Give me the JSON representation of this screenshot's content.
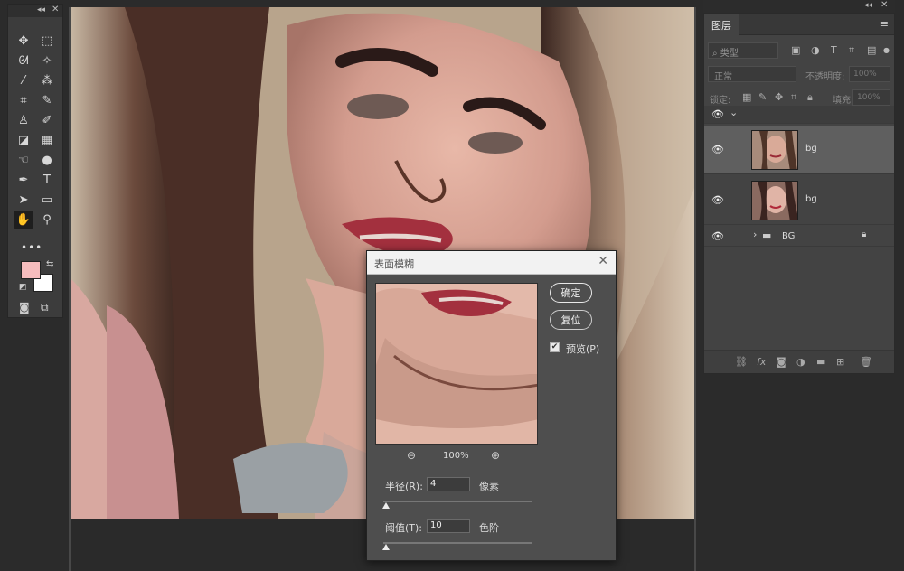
{
  "colors": {
    "foreground": "#f6bcbd",
    "background": "#ffffff"
  },
  "toolbox": {
    "tools": [
      {
        "name": "move-tool-icon",
        "glyph": "✥"
      },
      {
        "name": "marquee-tool-icon",
        "glyph": "⬚"
      },
      {
        "name": "lasso-tool-icon",
        "glyph": "ᘛ"
      },
      {
        "name": "magic-wand-tool-icon",
        "glyph": "✧"
      },
      {
        "name": "eyedropper-tool-icon",
        "glyph": "⁄"
      },
      {
        "name": "healing-tool-icon",
        "glyph": "⁂"
      },
      {
        "name": "crop-tool-icon",
        "glyph": "⌗"
      },
      {
        "name": "brush-tool-icon",
        "glyph": "✎"
      },
      {
        "name": "stamp-tool-icon",
        "glyph": "♙"
      },
      {
        "name": "history-brush-tool-icon",
        "glyph": "✐"
      },
      {
        "name": "eraser-tool-icon",
        "glyph": "◪"
      },
      {
        "name": "gradient-tool-icon",
        "glyph": "▦"
      },
      {
        "name": "smudge-tool-icon",
        "glyph": "☜"
      },
      {
        "name": "dodge-tool-icon",
        "glyph": "●"
      },
      {
        "name": "pen-tool-icon",
        "glyph": "✒"
      },
      {
        "name": "type-tool-icon",
        "glyph": "T"
      },
      {
        "name": "path-selection-tool-icon",
        "glyph": "➤"
      },
      {
        "name": "rectangle-tool-icon",
        "glyph": "▭"
      },
      {
        "name": "hand-tool-icon",
        "glyph": "✋"
      },
      {
        "name": "zoom-tool-icon",
        "glyph": "⚲"
      }
    ],
    "more": "•••"
  },
  "layers_panel": {
    "tab_label": "图层",
    "filter_placeholder": "⌕ 类型",
    "blend_mode": "正常",
    "opacity_label": "不透明度:",
    "opacity_value": "100%",
    "lock_label": "锁定:",
    "fill_label": "填充:",
    "fill_value": "100%",
    "layers": [
      {
        "name": "",
        "type": "group-open",
        "expand": "⌄"
      },
      {
        "name": "bg",
        "type": "image",
        "selected": true
      },
      {
        "name": "bg",
        "type": "image",
        "selected": false
      },
      {
        "name": "BG",
        "type": "folder",
        "expand": "›",
        "locked": true
      }
    ]
  },
  "dialog": {
    "title": "表面模糊",
    "close": "✕",
    "ok_label": "确定",
    "reset_label": "复位",
    "preview_checked": true,
    "preview_label": "预览(P)",
    "zoom_value": "100%",
    "radius_label": "半径(R):",
    "radius_value": "4",
    "radius_unit": "像素",
    "threshold_label": "阈值(T):",
    "threshold_value": "10",
    "threshold_unit": "色阶"
  }
}
